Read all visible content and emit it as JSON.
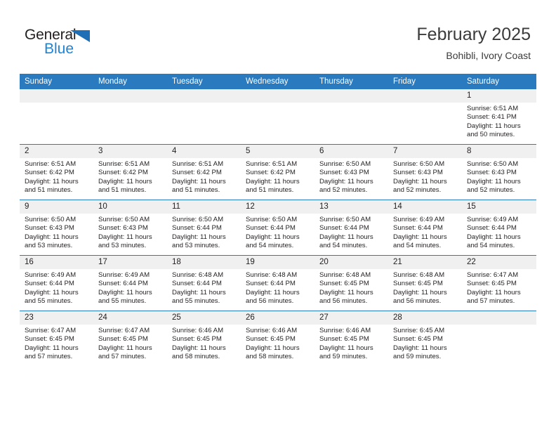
{
  "brand": {
    "name_top": "General",
    "name_bottom": "Blue",
    "accent_color": "#1f84d6",
    "triangle_color": "#1f6fb6"
  },
  "header": {
    "title": "February 2025",
    "subtitle": "Bohibli, Ivory Coast"
  },
  "theme": {
    "header_blue": "#2a7ac0",
    "daynum_band": "#f0f0f0",
    "text": "#231f20",
    "page_background": "#ffffff"
  },
  "labels": {
    "sunrise_prefix": "Sunrise:",
    "sunset_prefix": "Sunset:",
    "daylight_prefix": "Daylight:"
  },
  "weekdays": [
    "Sunday",
    "Monday",
    "Tuesday",
    "Wednesday",
    "Thursday",
    "Friday",
    "Saturday"
  ],
  "weeks": [
    [
      {
        "day": "",
        "blank": true
      },
      {
        "day": "",
        "blank": true
      },
      {
        "day": "",
        "blank": true
      },
      {
        "day": "",
        "blank": true
      },
      {
        "day": "",
        "blank": true
      },
      {
        "day": "",
        "blank": true
      },
      {
        "day": "1",
        "sunrise": "Sunrise: 6:51 AM",
        "sunset": "Sunset: 6:41 PM",
        "daylight": "Daylight: 11 hours and 50 minutes."
      }
    ],
    [
      {
        "day": "2",
        "sunrise": "Sunrise: 6:51 AM",
        "sunset": "Sunset: 6:42 PM",
        "daylight": "Daylight: 11 hours and 51 minutes."
      },
      {
        "day": "3",
        "sunrise": "Sunrise: 6:51 AM",
        "sunset": "Sunset: 6:42 PM",
        "daylight": "Daylight: 11 hours and 51 minutes."
      },
      {
        "day": "4",
        "sunrise": "Sunrise: 6:51 AM",
        "sunset": "Sunset: 6:42 PM",
        "daylight": "Daylight: 11 hours and 51 minutes."
      },
      {
        "day": "5",
        "sunrise": "Sunrise: 6:51 AM",
        "sunset": "Sunset: 6:42 PM",
        "daylight": "Daylight: 11 hours and 51 minutes."
      },
      {
        "day": "6",
        "sunrise": "Sunrise: 6:50 AM",
        "sunset": "Sunset: 6:43 PM",
        "daylight": "Daylight: 11 hours and 52 minutes."
      },
      {
        "day": "7",
        "sunrise": "Sunrise: 6:50 AM",
        "sunset": "Sunset: 6:43 PM",
        "daylight": "Daylight: 11 hours and 52 minutes."
      },
      {
        "day": "8",
        "sunrise": "Sunrise: 6:50 AM",
        "sunset": "Sunset: 6:43 PM",
        "daylight": "Daylight: 11 hours and 52 minutes."
      }
    ],
    [
      {
        "day": "9",
        "sunrise": "Sunrise: 6:50 AM",
        "sunset": "Sunset: 6:43 PM",
        "daylight": "Daylight: 11 hours and 53 minutes."
      },
      {
        "day": "10",
        "sunrise": "Sunrise: 6:50 AM",
        "sunset": "Sunset: 6:43 PM",
        "daylight": "Daylight: 11 hours and 53 minutes."
      },
      {
        "day": "11",
        "sunrise": "Sunrise: 6:50 AM",
        "sunset": "Sunset: 6:44 PM",
        "daylight": "Daylight: 11 hours and 53 minutes."
      },
      {
        "day": "12",
        "sunrise": "Sunrise: 6:50 AM",
        "sunset": "Sunset: 6:44 PM",
        "daylight": "Daylight: 11 hours and 54 minutes."
      },
      {
        "day": "13",
        "sunrise": "Sunrise: 6:50 AM",
        "sunset": "Sunset: 6:44 PM",
        "daylight": "Daylight: 11 hours and 54 minutes."
      },
      {
        "day": "14",
        "sunrise": "Sunrise: 6:49 AM",
        "sunset": "Sunset: 6:44 PM",
        "daylight": "Daylight: 11 hours and 54 minutes."
      },
      {
        "day": "15",
        "sunrise": "Sunrise: 6:49 AM",
        "sunset": "Sunset: 6:44 PM",
        "daylight": "Daylight: 11 hours and 54 minutes."
      }
    ],
    [
      {
        "day": "16",
        "sunrise": "Sunrise: 6:49 AM",
        "sunset": "Sunset: 6:44 PM",
        "daylight": "Daylight: 11 hours and 55 minutes."
      },
      {
        "day": "17",
        "sunrise": "Sunrise: 6:49 AM",
        "sunset": "Sunset: 6:44 PM",
        "daylight": "Daylight: 11 hours and 55 minutes."
      },
      {
        "day": "18",
        "sunrise": "Sunrise: 6:48 AM",
        "sunset": "Sunset: 6:44 PM",
        "daylight": "Daylight: 11 hours and 55 minutes."
      },
      {
        "day": "19",
        "sunrise": "Sunrise: 6:48 AM",
        "sunset": "Sunset: 6:44 PM",
        "daylight": "Daylight: 11 hours and 56 minutes."
      },
      {
        "day": "20",
        "sunrise": "Sunrise: 6:48 AM",
        "sunset": "Sunset: 6:45 PM",
        "daylight": "Daylight: 11 hours and 56 minutes."
      },
      {
        "day": "21",
        "sunrise": "Sunrise: 6:48 AM",
        "sunset": "Sunset: 6:45 PM",
        "daylight": "Daylight: 11 hours and 56 minutes."
      },
      {
        "day": "22",
        "sunrise": "Sunrise: 6:47 AM",
        "sunset": "Sunset: 6:45 PM",
        "daylight": "Daylight: 11 hours and 57 minutes."
      }
    ],
    [
      {
        "day": "23",
        "sunrise": "Sunrise: 6:47 AM",
        "sunset": "Sunset: 6:45 PM",
        "daylight": "Daylight: 11 hours and 57 minutes."
      },
      {
        "day": "24",
        "sunrise": "Sunrise: 6:47 AM",
        "sunset": "Sunset: 6:45 PM",
        "daylight": "Daylight: 11 hours and 57 minutes."
      },
      {
        "day": "25",
        "sunrise": "Sunrise: 6:46 AM",
        "sunset": "Sunset: 6:45 PM",
        "daylight": "Daylight: 11 hours and 58 minutes."
      },
      {
        "day": "26",
        "sunrise": "Sunrise: 6:46 AM",
        "sunset": "Sunset: 6:45 PM",
        "daylight": "Daylight: 11 hours and 58 minutes."
      },
      {
        "day": "27",
        "sunrise": "Sunrise: 6:46 AM",
        "sunset": "Sunset: 6:45 PM",
        "daylight": "Daylight: 11 hours and 59 minutes."
      },
      {
        "day": "28",
        "sunrise": "Sunrise: 6:45 AM",
        "sunset": "Sunset: 6:45 PM",
        "daylight": "Daylight: 11 hours and 59 minutes."
      },
      {
        "day": "",
        "blank": true
      }
    ]
  ]
}
